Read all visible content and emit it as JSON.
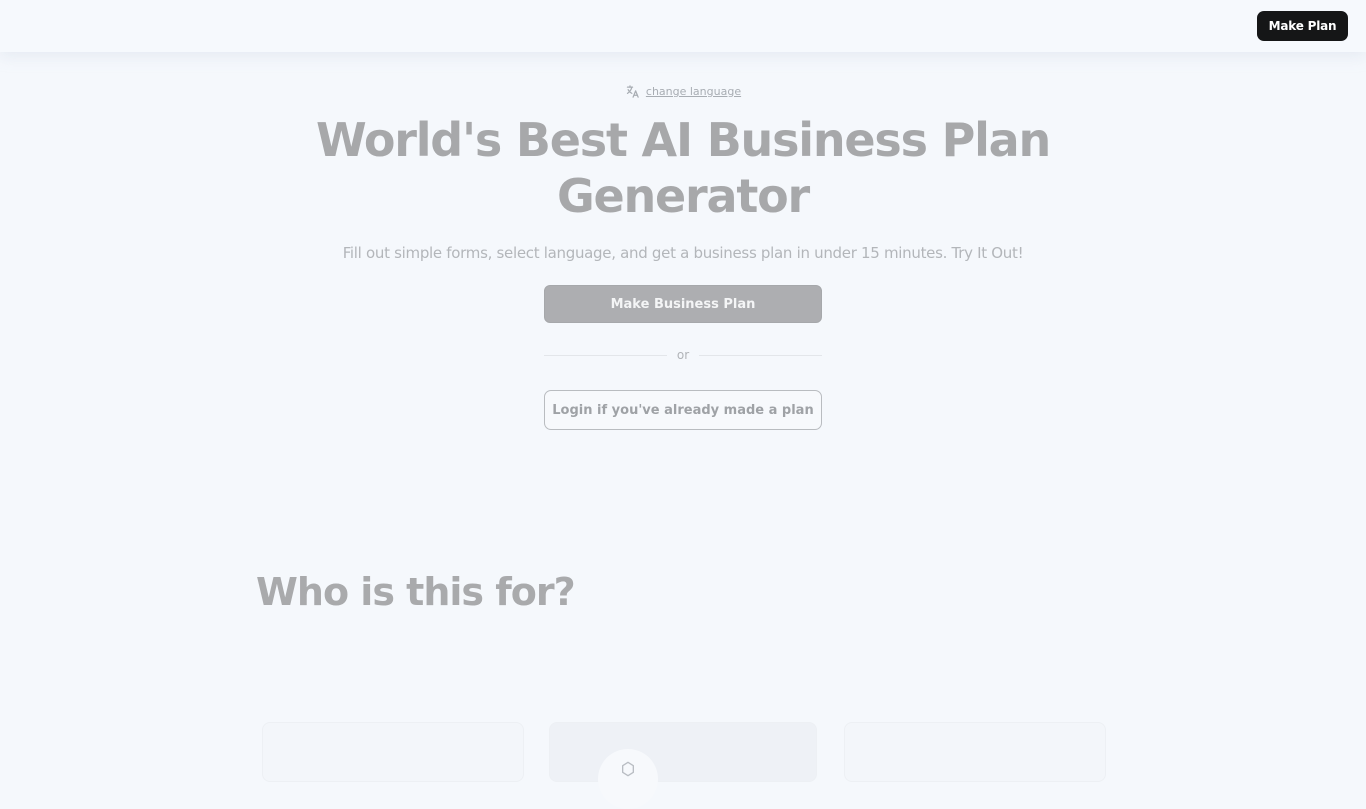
{
  "header": {
    "cta_label": "Make Plan"
  },
  "language": {
    "icon": "translate-icon",
    "link_text": "change language"
  },
  "hero": {
    "title_line1": "World's Best AI Business Plan",
    "title_line2": "Generator",
    "subtitle": "Fill out simple forms, select language, and get a business plan in under 15 minutes. Try It Out!",
    "primary_button": "Make Business Plan",
    "divider_text": "or",
    "secondary_button": "Login if you've already made a plan"
  },
  "audience": {
    "title": "Who is this for?",
    "cards": [
      {
        "icon": ""
      },
      {
        "icon": "shield-icon"
      },
      {
        "icon": ""
      }
    ]
  },
  "colors": {
    "page_bg": "#f5f8fc",
    "header_button_bg": "#151617",
    "primary_button_bg": "#adaeb1"
  }
}
